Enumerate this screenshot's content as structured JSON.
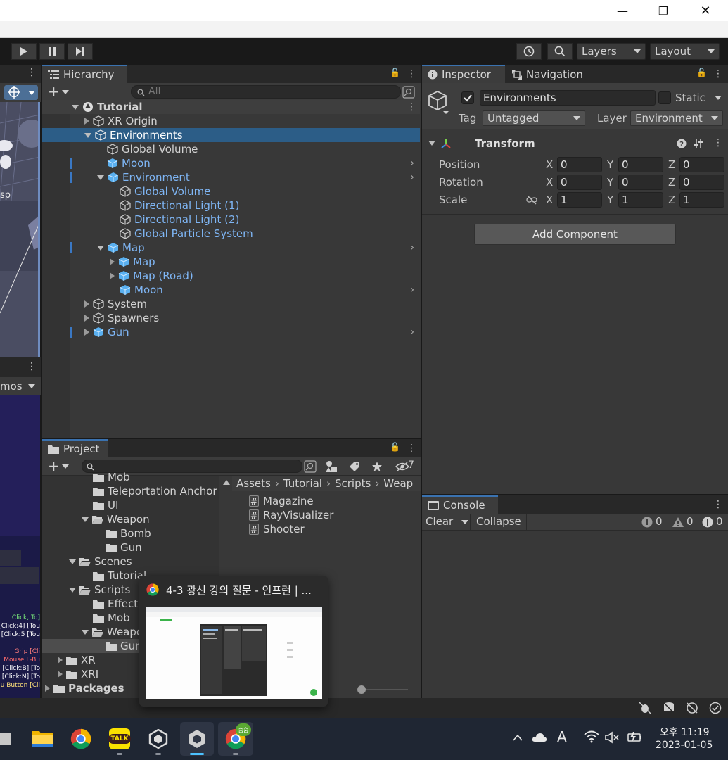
{
  "window": {
    "minimize": "—",
    "maximize": "❐",
    "close": "✕"
  },
  "toolbar": {
    "layers_label": "Layers",
    "layout_label": "Layout"
  },
  "hierarchy": {
    "tab_label": "Hierarchy",
    "search_placeholder": "All",
    "scene_name": "Tutorial",
    "rows": [
      {
        "label": "XR Origin"
      },
      {
        "label": "Environments"
      },
      {
        "label": "Global Volume"
      },
      {
        "label": "Moon"
      },
      {
        "label": "Environment"
      },
      {
        "label": "Global Volume"
      },
      {
        "label": "Directional Light (1)"
      },
      {
        "label": "Directional Light (2)"
      },
      {
        "label": "Global Particle System"
      },
      {
        "label": "Map"
      },
      {
        "label": "Map"
      },
      {
        "label": "Map (Road)"
      },
      {
        "label": "Moon"
      },
      {
        "label": "System"
      },
      {
        "label": "Spawners"
      },
      {
        "label": "Gun"
      }
    ]
  },
  "inspector": {
    "tab_label": "Inspector",
    "nav_tab_label": "Navigation",
    "object_name": "Environments",
    "static_label": "Static",
    "tag_label": "Tag",
    "tag_value": "Untagged",
    "layer_label": "Layer",
    "layer_value": "Environment",
    "component_title": "Transform",
    "position_label": "Position",
    "rotation_label": "Rotation",
    "scale_label": "Scale",
    "axis_x": "X",
    "axis_y": "Y",
    "axis_z": "Z",
    "position": [
      "0",
      "0",
      "0"
    ],
    "rotation": [
      "0",
      "0",
      "0"
    ],
    "scale": [
      "1",
      "1",
      "1"
    ],
    "add_component": "Add Component"
  },
  "project": {
    "tab_label": "Project",
    "hidden_count": "7",
    "breadcrumb": [
      "Assets",
      "Tutorial",
      "Scripts",
      "Weap"
    ],
    "tree": [
      {
        "label": "Mob"
      },
      {
        "label": "Teleportation Anchor"
      },
      {
        "label": "UI"
      },
      {
        "label": "Weapon"
      },
      {
        "label": "Bomb"
      },
      {
        "label": "Gun"
      },
      {
        "label": "Scenes"
      },
      {
        "label": "Tutorial"
      },
      {
        "label": "Scripts"
      },
      {
        "label": "Effect"
      },
      {
        "label": "Mob"
      },
      {
        "label": "Weapon"
      },
      {
        "label": "Gun"
      },
      {
        "label": "XR"
      },
      {
        "label": "XRI"
      },
      {
        "label": "Packages"
      }
    ],
    "files": [
      "Magazine",
      "RayVisualizer",
      "Shooter"
    ]
  },
  "console": {
    "tab_label": "Console",
    "clear": "Clear",
    "collapse": "Collapse",
    "log_count": "0",
    "warn_count": "0",
    "error_count": "0"
  },
  "scene_fragments": {
    "left_text": "sp",
    "gizmos_text": "mos"
  },
  "game_overlay": [
    "[Click, To",
    "s [Click:4] [Tou",
    "is [Click:5 [Tou",
    "Grip [Cli",
    "Mouse L-Bu",
    "n [Click:B] [To",
    "n [Click:N] [To",
    "u Button [Cli"
  ],
  "preview": {
    "title": "4-3 광선 강의 질문 - 인프런 | ..."
  },
  "taskbar": {
    "kakao_label": "TALK",
    "chrome_badge": "숨숨",
    "ime": "A",
    "time": "오후 11:19",
    "date": "2023-01-05"
  },
  "colors": {
    "selection": "#2c5d87",
    "prefab_text": "#7fb6f5",
    "tab_accent": "#3a72b0"
  }
}
